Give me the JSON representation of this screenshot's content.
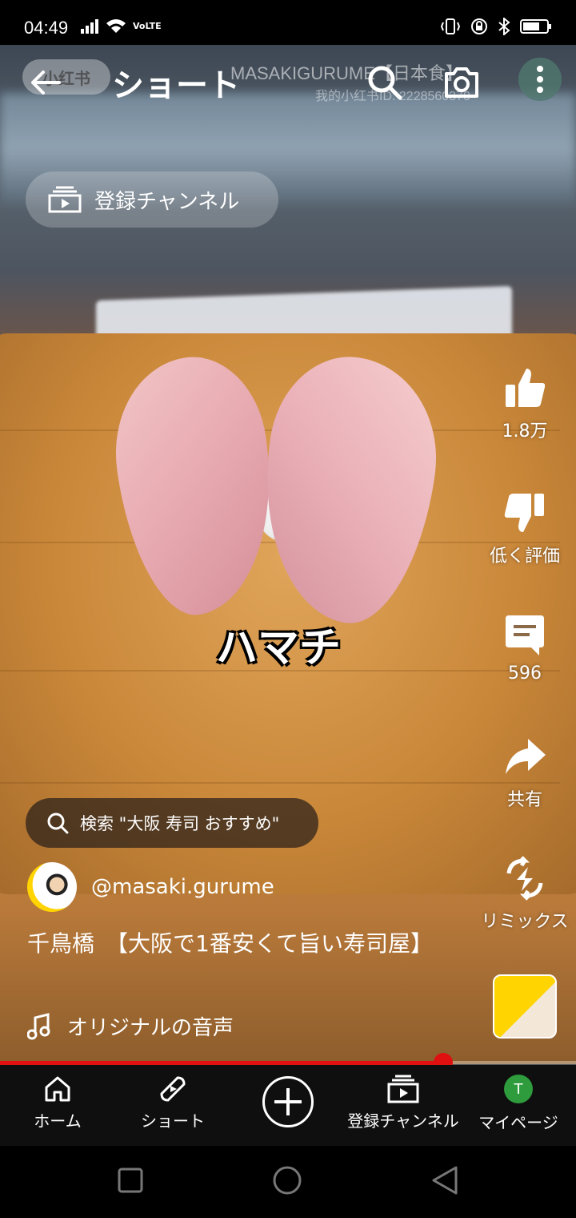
{
  "status": {
    "time": "04:49",
    "network": "VoLTE"
  },
  "video": {
    "caption": "ハマチ",
    "watermark_title": "MASAKIGURUME【日本食】",
    "watermark_id": "我的小红书ID: 2228560370",
    "watermark_logo": "小红书"
  },
  "top_bar": {
    "title": "ショート"
  },
  "subscriptions_chip": {
    "label": "登録チャンネル"
  },
  "actions": {
    "like_count": "1.8万",
    "dislike_label": "低く評価",
    "comment_count": "596",
    "share_label": "共有",
    "remix_label": "リミックス"
  },
  "search_suggestion": {
    "label": "検索 \"大阪 寿司 おすすめ\""
  },
  "channel": {
    "handle": "@masaki.gurume"
  },
  "video_title": "千鳥橋　【大阪で1番安くて旨い寿司屋】",
  "sound": {
    "label": "オリジナルの音声"
  },
  "progress": {
    "fraction": 0.77
  },
  "bottom_nav": {
    "home": "ホーム",
    "shorts": "ショート",
    "subscriptions": "登録チャンネル",
    "mypage": "マイページ",
    "avatar_initial": "T"
  },
  "colors": {
    "accent_red": "#e01010",
    "nav_bg": "#0f0f0f",
    "avatar_green": "#2e9b3c"
  }
}
